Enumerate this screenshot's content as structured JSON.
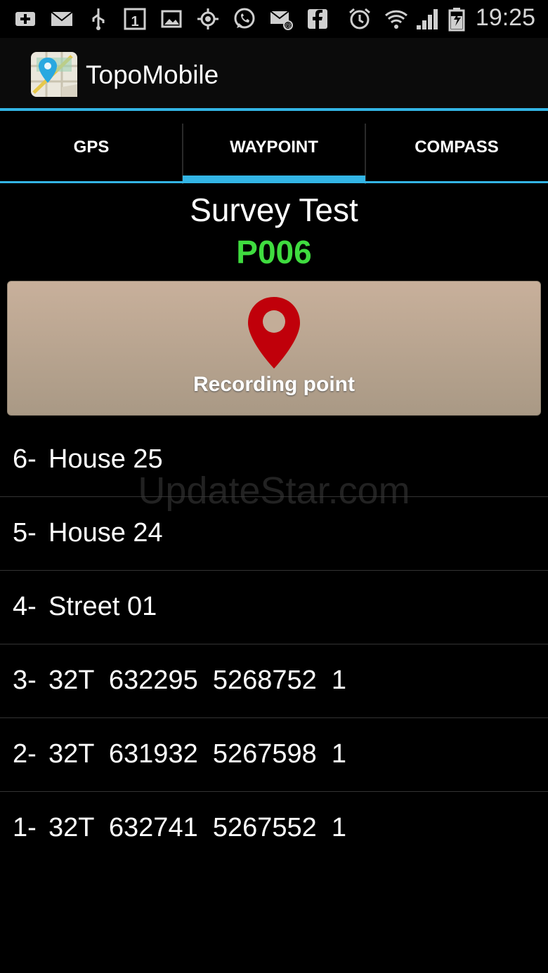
{
  "status_bar": {
    "icons": [
      "add-icon",
      "mail-icon",
      "usb-icon",
      "calendar-icon",
      "image-icon",
      "gps-icon",
      "whatsapp-icon",
      "email-icon",
      "facebook-icon",
      "alarm-icon",
      "wifi-icon",
      "signal-icon",
      "battery-icon"
    ],
    "calendar_day": "1",
    "time": "19:25"
  },
  "app": {
    "title": "TopoMobile"
  },
  "tabs": [
    {
      "label": "GPS"
    },
    {
      "label": "WAYPOINT",
      "selected": true
    },
    {
      "label": "COMPASS"
    }
  ],
  "survey": {
    "title": "Survey Test",
    "point_code": "P006"
  },
  "record_button": {
    "label": "Recording point"
  },
  "points": [
    {
      "index": "6-",
      "text": "House 25"
    },
    {
      "index": "5-",
      "text": "House 24"
    },
    {
      "index": "4-",
      "text": "Street 01"
    },
    {
      "index": "3-",
      "text": "32T  632295  5268752  1"
    },
    {
      "index": "2-",
      "text": "32T  631932  5267598  1"
    },
    {
      "index": "1-",
      "text": "32T  632741  5267552  1"
    }
  ],
  "watermark": "UpdateStar.com",
  "colors": {
    "accent": "#33b5e5",
    "code_green": "#3fdc3f",
    "pin_red": "#c0000a"
  }
}
